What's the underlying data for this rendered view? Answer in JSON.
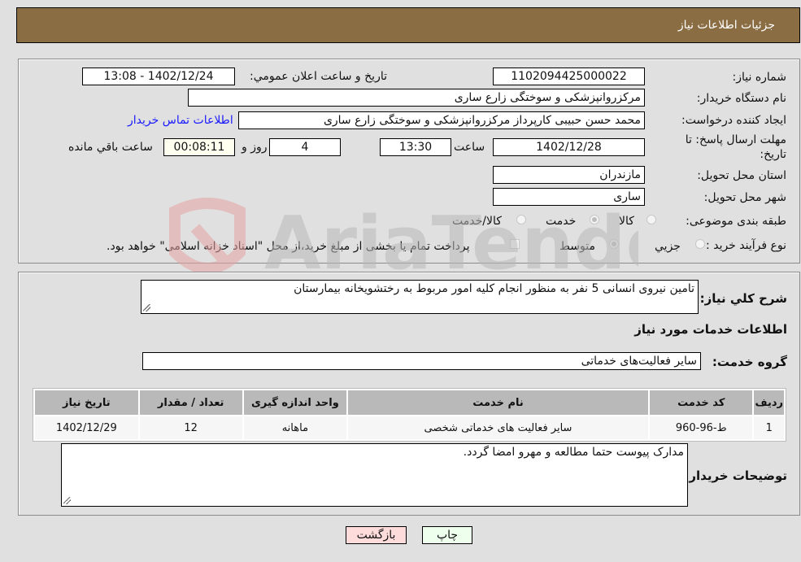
{
  "header": {
    "title": "جزئیات اطلاعات نیاز"
  },
  "form": {
    "need_number_label": "شماره نیاز:",
    "need_number": "1102094425000022",
    "announce_label": "تاريخ و ساعت اعلان عمومي:",
    "announce_value": "1402/12/24 - 13:08",
    "buyer_org_label": "نام دستگاه خریدار:",
    "buyer_org": "مرکزروانپزشکی و سوختگی زارع ساری",
    "creator_label": "ایجاد کننده درخواست:",
    "creator": "محمد حسن حبیبی کارپرداز مرکزروانپزشکی و سوختگی زارع ساری",
    "contact_link": "اطلاعات تماس خریدار",
    "deadline_label_line1": "مهلت ارسال پاسخ: تا",
    "deadline_label_line2": "تاریخ:",
    "deadline_date": "1402/12/28",
    "time_label": "ساعت",
    "deadline_time": "13:30",
    "days_value": "4",
    "days_label": "روز و",
    "remaining_time": "00:08:11",
    "remaining_label": "ساعت باقي مانده",
    "province_label": "استان محل تحویل:",
    "province": "مازندران",
    "city_label": "شهر محل تحویل:",
    "city": "ساری",
    "category_label": "طبقه بندی موضوعی:",
    "category_options": [
      {
        "label": "کالا",
        "checked": false
      },
      {
        "label": "خدمت",
        "checked": true
      },
      {
        "label": "کالا/خدمت",
        "checked": false
      }
    ],
    "process_label": "نوع فرآیند خرید :",
    "process_options": [
      {
        "label": "جزيي",
        "checked": false
      },
      {
        "label": "متوسط",
        "checked": true
      }
    ],
    "treasury_note": "پرداخت تمام یا بخشی از مبلغ خرید،از محل \"اسناد خزانه اسلامی\" خواهد بود.",
    "treasury_checked": false
  },
  "details": {
    "description_label": "شرح كلي نياز:",
    "description": "تامین نیروی انسانی 5 نفر به منظور انجام کلیه امور مربوط به رختشویخانه بیمارستان",
    "services_heading": "اطلاعات خدمات مورد نياز",
    "service_group_label": "گروه خدمت:",
    "service_group": "سایر فعالیت‌های خدماتی",
    "table": {
      "headers": [
        "رديف",
        "کد خدمت",
        "نام خدمت",
        "واحد اندازه گیری",
        "تعداد / مقدار",
        "تاريخ نياز"
      ],
      "rows": [
        [
          "1",
          "ط-96-960",
          "سایر فعالیت های خدماتی شخصی",
          "ماهانه",
          "12",
          "1402/12/29"
        ]
      ]
    },
    "buyer_notes_label": "توضيحات خريدار:",
    "buyer_notes": "مدارک پیوست حتما مطالعه و مهرو امضا گردد."
  },
  "buttons": {
    "print": "چاپ",
    "back": "بازگشت"
  },
  "colors": {
    "header_bg": "#8b6d43",
    "print_bg": "#eeffee",
    "back_bg": "#ffdcdc"
  }
}
